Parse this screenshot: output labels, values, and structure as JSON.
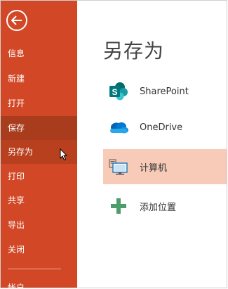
{
  "colors": {
    "sidebar": "#d24726",
    "sidebar_selected": "#a93c1d",
    "location_selected": "#f7cbb8"
  },
  "sidebar": {
    "back_icon": "back-arrow-icon",
    "items": [
      {
        "label": "信息"
      },
      {
        "label": "新建"
      },
      {
        "label": "打开"
      },
      {
        "label": "保存"
      },
      {
        "label": "另存为"
      },
      {
        "label": "打印"
      },
      {
        "label": "共享"
      },
      {
        "label": "导出"
      },
      {
        "label": "关闭"
      },
      {
        "label": "帐户"
      }
    ]
  },
  "main": {
    "title": "另存为",
    "locations": [
      {
        "label": "SharePoint",
        "icon": "sharepoint-icon"
      },
      {
        "label": "OneDrive",
        "icon": "onedrive-icon"
      },
      {
        "label": "计算机",
        "icon": "computer-icon"
      },
      {
        "label": "添加位置",
        "icon": "add-place-icon"
      }
    ]
  }
}
